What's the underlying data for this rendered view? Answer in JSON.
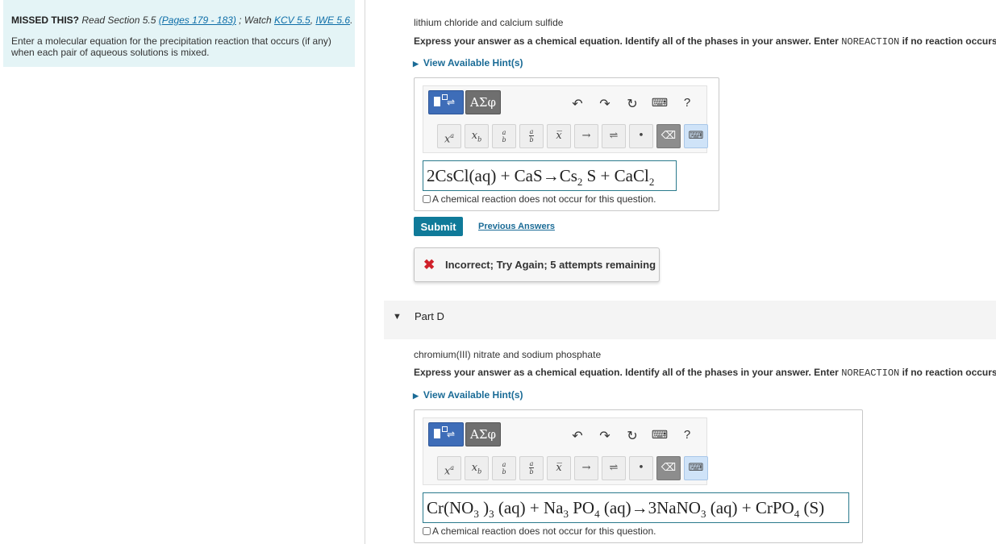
{
  "sidebar": {
    "missed_label": "MISSED THIS?",
    "read_text": "Read Section 5.5",
    "pages_link": "(Pages 179 - 183)",
    "watch_text": "; Watch",
    "kcv_link": "KCV 5.5",
    "comma": ",",
    "iwe_link": "IWE 5.6",
    "period": ".",
    "instructions": "Enter a molecular equation for the precipitation reaction that occurs (if any) when each pair of aqueous solutions is mixed."
  },
  "partC": {
    "prompt": "lithium chloride and calcium sulfide",
    "express_a": "Express your answer as a chemical equation. Identify all of the phases in your answer. Enter",
    "express_code": "NOREACTION",
    "express_b": "if no reaction occurs.",
    "hint_label": "View Available Hint(s)",
    "answer": {
      "coef": "2CsCl(aq) + CaS",
      "arrow": "→",
      "p1": "Cs",
      "s1": "2",
      "p2": " S + CaCl",
      "s2": "2"
    },
    "no_reaction_label": "A chemical reaction does not occur for this question.",
    "submit_label": "Submit",
    "previous_label": "Previous Answers",
    "feedback_icon": "✖",
    "feedback_text": "Incorrect; Try Again; 5 attempts remaining"
  },
  "partD": {
    "header_label": "Part D",
    "prompt": "chromium(III) nitrate and sodium phosphate",
    "express_a": "Express your answer as a chemical equation. Identify all of the phases in your answer. Enter",
    "express_code": "NOREACTION",
    "express_b": "if no reaction occurs.",
    "hint_label": "View Available Hint(s)",
    "answer": {
      "a": "Cr(NO",
      "sa": "3",
      "b": " )",
      "sb": "3",
      "c": " (aq) + Na",
      "sc": "3",
      "d": " PO",
      "sd": "4",
      "e": " (aq)",
      "arrow": "→",
      "f": "3NaNO",
      "sf": "3",
      "g": " (aq) + CrPO",
      "sg": "4",
      "h": " (S)"
    },
    "no_reaction_label": "A chemical reaction does not occur for this question."
  },
  "toolbar": {
    "greek_label": "ΑΣφ",
    "undo": "↶",
    "redo": "↷",
    "reset": "↻",
    "keyboard": "⌨",
    "help": "?",
    "arrow": "→",
    "equilibrium": "⇌",
    "dot": "•",
    "backspace": "⌫"
  },
  "colors": {
    "accent": "#0f7a99",
    "link": "#1a6b96",
    "template_btn": "#3e6db8",
    "error": "#d0202a",
    "sidebar_bg": "#e4f4f6"
  }
}
